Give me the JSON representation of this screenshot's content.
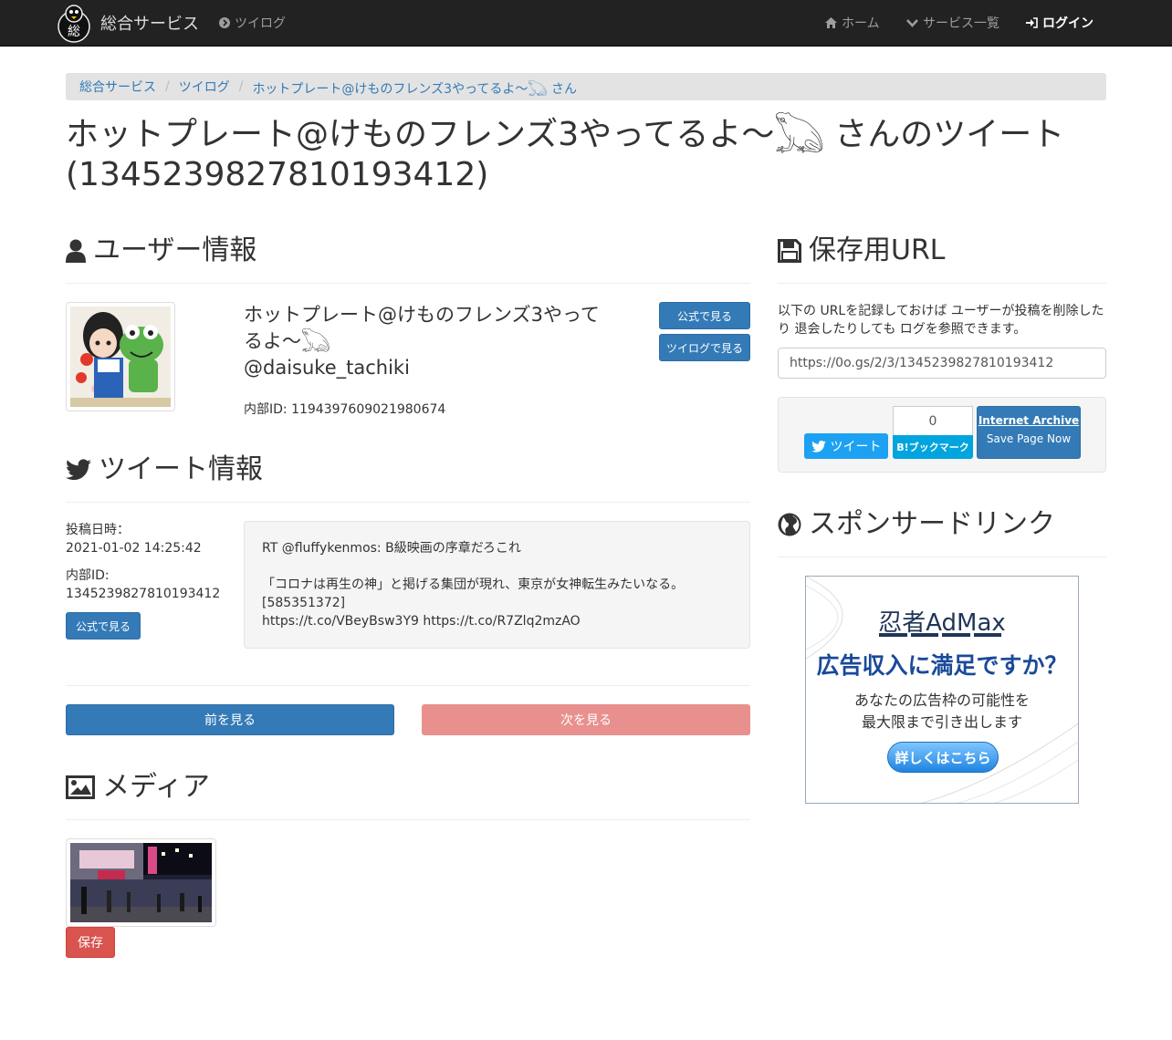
{
  "navbar": {
    "brand": "総合サービス",
    "logo_glyph": "総",
    "left_links": [
      {
        "label": "ツイログ",
        "icon": "chevron-circle-right-icon"
      }
    ],
    "right_links": [
      {
        "label": "ホーム",
        "icon": "home-icon"
      },
      {
        "label": "サービス一覧",
        "icon": "chevron-down-icon"
      },
      {
        "label": "ログイン",
        "icon": "sign-in-icon"
      }
    ]
  },
  "breadcrumb": [
    "総合サービス",
    "ツイログ",
    "ホットプレート@けものフレンズ3やってるよ～𓆏 さん"
  ],
  "page_title": "ホットプレート@けものフレンズ3やってるよ～𓆏 さんのツイート(1345239827810193412)",
  "user_section": {
    "heading": "ユーザー情報",
    "name_line1": "ホットプレート@けものフレンズ3やって",
    "name_line2": "るよ～𓆏",
    "handle": "@daisuke_tachiki",
    "internal_id": "内部ID: 1194397609021980674",
    "btn_official": "公式で見る",
    "btn_twilog": "ツイログで見る"
  },
  "tweet_section": {
    "heading": "ツイート情報",
    "posted_label": "投稿日時：",
    "posted_value": "2021-01-02 14:25:42",
    "id_label": "内部ID:",
    "id_value": "1345239827810193412",
    "btn_official": "公式で見る",
    "text_lines": [
      "RT @fluffykenmos: B級映画の序章だろこれ",
      "",
      "「コロナは再生の神」と掲げる集団が現れ、東京が女神転生みたいなる。",
      "[585351372]",
      "https://t.co/VBeyBsw3Y9 https://t.co/R7Zlq2mzAO"
    ]
  },
  "pager": {
    "prev": "前を見る",
    "next": "次を見る"
  },
  "media_section": {
    "heading": "メディア",
    "save_btn": "保存"
  },
  "save_section": {
    "heading": "保存用URL",
    "description": "以下の URLを記録しておけば ユーザーが投稿を削除したり 退会したりしても ログを参照できます。",
    "url": "https://0o.gs/2/3/1345239827810193412",
    "tweet_btn": "ツイート",
    "hatena_count": "0",
    "hatena_btn": "B!ブックマーク",
    "ia_title": "Internet Archive",
    "ia_sub": "Save Page Now"
  },
  "sponsor_section": {
    "heading": "スポンサードリンク",
    "ad_title": "忍者AdMax",
    "ad_headline": "広告収入に満足ですか？",
    "ad_sub1": "あなたの広告枠の可能性を",
    "ad_sub2": "最大限まで引き出します",
    "ad_button": "詳しくはこちら"
  },
  "colors": {
    "primary": "#337ab7",
    "danger": "#d9534f",
    "navbar": "#222222",
    "twitter": "#1da1f2",
    "hatena": "#00a4de"
  }
}
